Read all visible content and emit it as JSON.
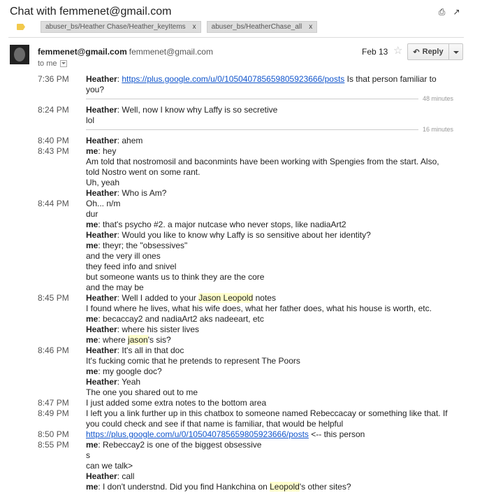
{
  "header": {
    "title": "Chat with femmenet@gmail.com",
    "labels": [
      "abuser_bs/Heather Chase/Heather_keyItems",
      "abuser_bs/HeatherChase_all"
    ],
    "label_close": "x",
    "print_icon": "printer-icon",
    "popout_icon": "new-window-icon"
  },
  "message": {
    "sender_name": "femmenet@gmail.com",
    "sender_email": "femmenet@gmail.com",
    "to": "to me",
    "date": "Feb 13",
    "reply_label": "Reply"
  },
  "gaps": [
    "48 minutes",
    "16 minutes"
  ],
  "chat": [
    {
      "time": "7:36 PM",
      "lines": [
        "@@B@@Heather@@E@@: @@A@@https://plus.google.com/u/0/105040785659805923666/posts@@Z@@ Is that person familiar to",
        "you?"
      ]
    },
    {
      "time": "8:24 PM",
      "lines": [
        "@@B@@Heather@@E@@: Well, now I know why Laffy is so secretive",
        "lol"
      ]
    },
    {
      "time": "8:40 PM",
      "lines": [
        "@@B@@Heather@@E@@: ahem"
      ]
    },
    {
      "time": "8:43 PM",
      "lines": [
        "@@B@@me@@E@@: hey",
        "Am told that nostromosil and baconmints have been working with Spengies from the start. Also,",
        "told Nostro went on some rant.",
        "Uh, yeah",
        "@@B@@Heather@@E@@: Who is Am?"
      ]
    },
    {
      "time": "8:44 PM",
      "lines": [
        "Oh... n/m",
        "dur",
        "@@B@@me@@E@@: that's psycho #2. a major nutcase who never stops, like nadiaArt2",
        "@@B@@Heather@@E@@: Would you like to know why Laffy is so sensitive about her identity?",
        "@@B@@me@@E@@: theyr; the \"obsessives\"",
        "and the very ill ones",
        "they feed info and snivel",
        "but someone wants us to think they are the core",
        "and the may be"
      ]
    },
    {
      "time": "8:45 PM",
      "lines": [
        "@@B@@Heather@@E@@: Well I added to your @@H@@Jason Leopold@@Y@@ notes",
        "I found where he lives, what his wife does, what her father does, what his house is worth, etc.",
        "@@B@@me@@E@@: becaccay2 and nadiaArt2 aks nadeeart, etc",
        "@@B@@Heather@@E@@: where his sister lives",
        "@@B@@me@@E@@: where @@H@@jason@@Y@@'s sis?"
      ]
    },
    {
      "time": "8:46 PM",
      "lines": [
        "@@B@@Heather@@E@@: It's all in that doc",
        "It's fucking comic that he pretends to represent The Poors",
        "@@B@@me@@E@@: my google doc?",
        "@@B@@Heather@@E@@: Yeah",
        "The one you shared out to me"
      ]
    },
    {
      "time": "8:47 PM",
      "lines": [
        "I just added some extra notes to the bottom area"
      ]
    },
    {
      "time": "8:49 PM",
      "lines": [
        "I left you a link further up in this chatbox to someone named Rebeccacay or something like that. If",
        "you could check and see if that name is familiar, that would be helpful"
      ]
    },
    {
      "time": "8:50 PM",
      "lines": [
        "@@A@@https://plus.google.com/u/0/105040785659805923666/posts@@Z@@ <-- this person"
      ]
    },
    {
      "time": "8:55 PM",
      "lines": [
        "@@B@@me@@E@@: Rebeccay2 is one of the biggest obsessive",
        "s",
        "can we talk>",
        "@@B@@Heather@@E@@: call",
        "@@B@@me@@E@@: I don't understnd. Did you find Hankchina on @@H@@Leopold@@Y@@'s other sites?"
      ]
    }
  ]
}
